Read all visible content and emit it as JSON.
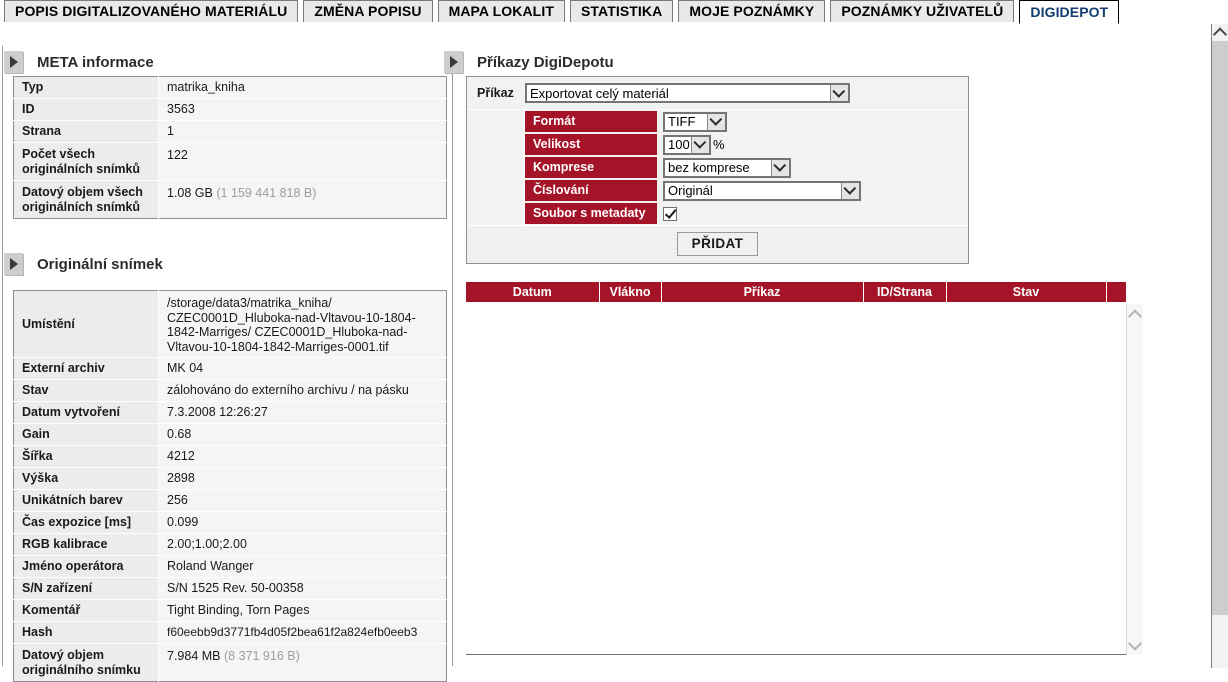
{
  "tabs": [
    {
      "label": "POPIS DIGITALIZOVANÉHO MATERIÁLU",
      "active": false
    },
    {
      "label": "ZMĚNA POPISU",
      "active": false
    },
    {
      "label": "MAPA LOKALIT",
      "active": false
    },
    {
      "label": "STATISTIKA",
      "active": false
    },
    {
      "label": "MOJE POZNÁMKY",
      "active": false
    },
    {
      "label": "POZNÁMKY UŽIVATELŮ",
      "active": false
    },
    {
      "label": "DIGIDEPOT",
      "active": true
    }
  ],
  "panels": {
    "meta": {
      "title": "META informace",
      "toggle_icon": "triangle-right-icon",
      "rows": [
        {
          "key": "Typ",
          "value": "matrika_kniha",
          "extra": ""
        },
        {
          "key": "ID",
          "value": "3563",
          "extra": ""
        },
        {
          "key": "Strana",
          "value": "1",
          "extra": ""
        },
        {
          "key": "Počet všech originálních snímků",
          "value": "122",
          "extra": ""
        },
        {
          "key": "Datový objem všech originálních snímků",
          "value": "1.08 GB",
          "extra": "(1 159 441 818 B)"
        }
      ]
    },
    "original": {
      "title": "Originální snímek",
      "toggle_icon": "triangle-right-icon",
      "rows": [
        {
          "key": "Umístění",
          "value": "/storage/data3/matrika_kniha/ CZEC0001D_Hluboka-nad-Vltavou-10-1804-1842-Marriges/ CZEC0001D_Hluboka-nad-Vltavou-10-1804-1842-Marriges-0001.tif",
          "extra": ""
        },
        {
          "key": "Externí archiv",
          "value": "MK 04",
          "extra": ""
        },
        {
          "key": "Stav",
          "value": "zálohováno do externího archivu / na pásku",
          "extra": ""
        },
        {
          "key": "Datum vytvoření",
          "value": "7.3.2008 12:26:27",
          "extra": ""
        },
        {
          "key": "Gain",
          "value": "0.68",
          "extra": ""
        },
        {
          "key": "Šířka",
          "value": "4212",
          "extra": ""
        },
        {
          "key": "Výška",
          "value": "2898",
          "extra": ""
        },
        {
          "key": "Unikátních barev",
          "value": "256",
          "extra": ""
        },
        {
          "key": "Čas expozice [ms]",
          "value": "0.099",
          "extra": ""
        },
        {
          "key": "RGB kalibrace",
          "value": "2.00;1.00;2.00",
          "extra": ""
        },
        {
          "key": "Jméno operátora",
          "value": "Roland Wanger",
          "extra": ""
        },
        {
          "key": "S/N zařízení",
          "value": "S/N 1525 Rev. 50-00358",
          "extra": ""
        },
        {
          "key": "Komentář",
          "value": "Tight Binding, Torn Pages",
          "extra": ""
        },
        {
          "key": "Hash",
          "value": "f60eebb9d3771fb4d05f2bea61f2a824efb0eeb3",
          "extra": ""
        },
        {
          "key": "Datový objem originálního snímku",
          "value": "7.984 MB",
          "extra": "(8 371 916 B)"
        }
      ]
    },
    "commands": {
      "title": "Příkazy DigiDepotu",
      "toggle_icon": "triangle-right-icon",
      "command_label": "Příkaz",
      "command_value": "Exportovat celý materiál",
      "options": [
        {
          "key": "Formát",
          "type": "select",
          "value": "TIFF",
          "suffix": ""
        },
        {
          "key": "Velikost",
          "type": "select",
          "value": "100",
          "suffix": "%"
        },
        {
          "key": "Komprese",
          "type": "select",
          "value": "bez komprese",
          "suffix": ""
        },
        {
          "key": "Číslování",
          "type": "select",
          "value": "Originál",
          "suffix": ""
        },
        {
          "key": "Soubor s metadaty",
          "type": "checkbox",
          "value": "checked",
          "suffix": ""
        }
      ],
      "add_button": "PŘIDAT"
    }
  },
  "job_table": {
    "columns": [
      "Datum",
      "Vlákno",
      "Příkaz",
      "ID/Strana",
      "Stav",
      ""
    ],
    "rows": []
  },
  "colors": {
    "accent_red": "#a51328",
    "tab_active_text": "#123c70",
    "panel_bg": "#f2f2f2"
  }
}
